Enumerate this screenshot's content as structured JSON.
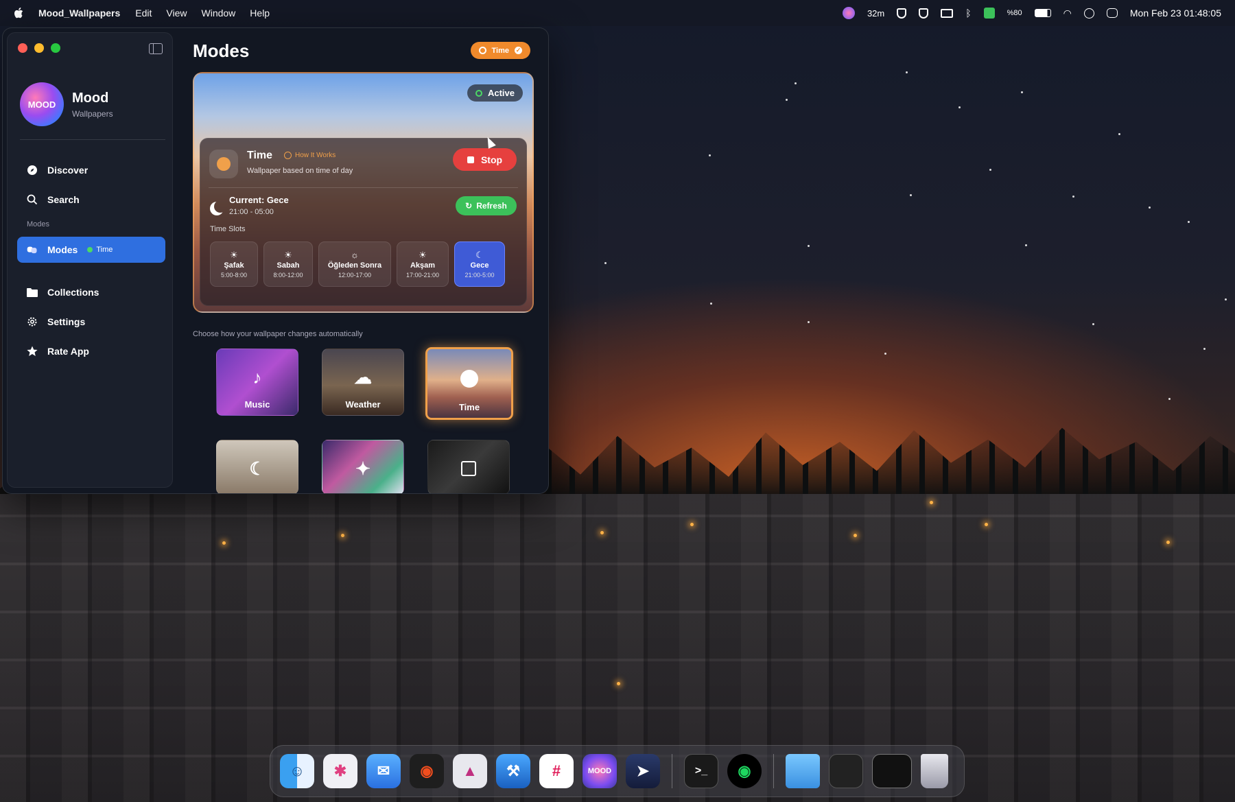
{
  "menubar": {
    "app_name": "Mood_Wallpapers",
    "menus": [
      "Edit",
      "View",
      "Window",
      "Help"
    ],
    "timer": "32m",
    "battery": "%80",
    "datetime": "Mon Feb 23  01:48:05"
  },
  "sidebar": {
    "brand_logo_text": "MOOD",
    "brand_name": "Mood",
    "brand_sub": "Wallpapers",
    "section_label": "Modes",
    "items": [
      {
        "label": "Discover",
        "icon": "compass-icon"
      },
      {
        "label": "Search",
        "icon": "search-icon"
      },
      {
        "label": "Modes",
        "icon": "masks-icon",
        "badge": "Time"
      },
      {
        "label": "Collections",
        "icon": "folder-icon"
      },
      {
        "label": "Settings",
        "icon": "gear-icon"
      },
      {
        "label": "Rate App",
        "icon": "star-icon"
      }
    ]
  },
  "main": {
    "title": "Modes",
    "top_badge": "Time",
    "hero": {
      "status": "Active",
      "mode_title": "Time",
      "how_it_works": "How It Works",
      "description": "Wallpaper based on time of day",
      "stop_label": "Stop",
      "current_title": "Current: Gece",
      "current_range": "21:00 - 05:00",
      "refresh_label": "Refresh",
      "slots_label": "Time Slots",
      "slots": [
        {
          "name": "Şafak",
          "time": "5:00-8:00",
          "icon": "sunrise-icon"
        },
        {
          "name": "Sabah",
          "time": "8:00-12:00",
          "icon": "sunrise-icon"
        },
        {
          "name": "Öğleden Sonra",
          "time": "12:00-17:00",
          "icon": "sun-icon"
        },
        {
          "name": "Akşam",
          "time": "17:00-21:00",
          "icon": "sunset-icon"
        },
        {
          "name": "Gece",
          "time": "21:00-5:00",
          "icon": "moon-icon",
          "selected": true
        }
      ]
    },
    "choose_text": "Choose how your wallpaper changes automatically",
    "modes": [
      {
        "label": "Music",
        "icon": "music-note-icon"
      },
      {
        "label": "Weather",
        "icon": "cloud-sun-icon"
      },
      {
        "label": "Time",
        "icon": "clock-icon",
        "selected": true
      },
      {
        "label": "",
        "icon": "moon-icon"
      },
      {
        "label": "",
        "icon": "sparkle-icon"
      },
      {
        "label": "",
        "icon": "cpu-icon"
      }
    ]
  },
  "dock": {
    "apps": [
      "Finder",
      "Launchpad",
      "Mail",
      "Figma",
      "Affinity",
      "Xcode",
      "Slack",
      "Mood",
      "Proxyman",
      "Terminal",
      "Spotify",
      "Downloads",
      "Screenshot",
      "Window",
      "Trash"
    ]
  }
}
